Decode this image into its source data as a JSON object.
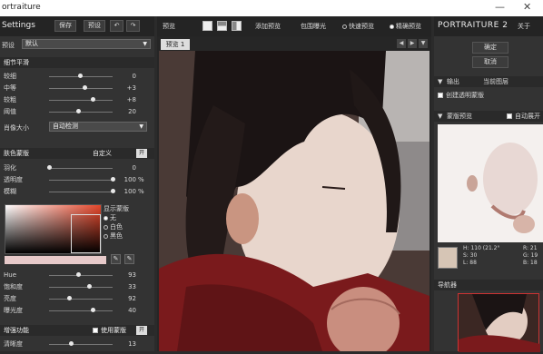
{
  "window": {
    "title": "ortraiture",
    "minimize": "—",
    "close": "✕"
  },
  "left": {
    "header": {
      "title": "Settings",
      "save": "保存",
      "preset": "预设",
      "undo": "↶",
      "redo": "↷"
    },
    "preset_row": {
      "label": "预设",
      "value": "默认"
    },
    "detail": {
      "title": "细节平滑",
      "rows": [
        {
          "label": "较细",
          "value": "0"
        },
        {
          "label": "中等",
          "value": "+3"
        },
        {
          "label": "较粗",
          "value": "+8"
        },
        {
          "label": "阈值",
          "value": "20"
        }
      ],
      "size_label": "肖像大小",
      "size_value": "自动检测"
    },
    "skin": {
      "title": "肤色蒙版",
      "mode": "自定义",
      "rows": [
        {
          "label": "羽化",
          "value": "0",
          "pct": ""
        },
        {
          "label": "透明度",
          "value": "100",
          "pct": "%"
        },
        {
          "label": "模糊",
          "value": "100",
          "pct": "%"
        }
      ],
      "show_mask": "显示蒙版",
      "options": [
        "无",
        "白色",
        "黑色"
      ],
      "hsl": [
        {
          "label": "Hue",
          "value": "93"
        },
        {
          "label": "饱和度",
          "value": "33"
        },
        {
          "label": "亮度",
          "value": "92"
        },
        {
          "label": "曝光度",
          "value": "40"
        }
      ]
    },
    "enhance": {
      "title": "增强功能",
      "use_mask": "使用蒙版",
      "row": {
        "label": "清晰度",
        "value": "13"
      }
    }
  },
  "center": {
    "preview_label": "预览",
    "add_preview": "添加预览",
    "bracket": "包围曝光",
    "quick": "快速预览",
    "fine": "精确预览",
    "tab": "预览 1"
  },
  "right": {
    "brand": "PORTRAITURE 2",
    "about": "关于",
    "ok": "确定",
    "cancel": "取消",
    "output_title": "输出",
    "output_value": "当前图层",
    "transparent": "创建透明蒙版",
    "mask_preview": "蒙版预览",
    "auto_expand": "自动展开",
    "color": {
      "h": "H: 110 (21.2°",
      "r": "R: 21",
      "s": "S: 30",
      "g": "G: 19",
      "l": "L: 88",
      "b": "B: 18"
    },
    "navigator": "导航器"
  }
}
